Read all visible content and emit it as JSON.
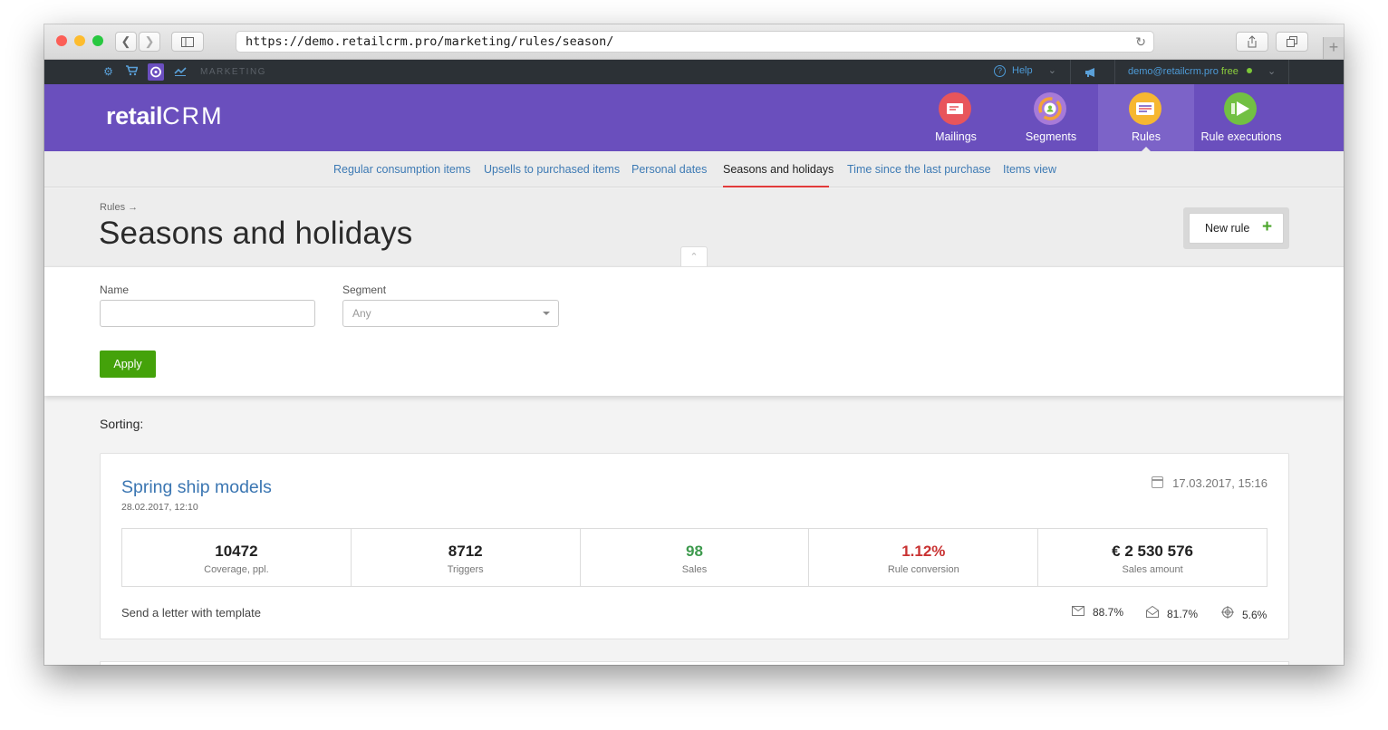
{
  "browser": {
    "url": "https://demo.retailcrm.pro/marketing/rules/season/",
    "reload_icon": "reload-icon",
    "new_tab": "+"
  },
  "topbar": {
    "section": "MARKETING",
    "help": "Help",
    "user_email": "demo@retailcrm.pro",
    "plan": "free"
  },
  "header": {
    "logo_text": "retail",
    "logo_crm": "CRM",
    "nav": [
      {
        "label": "Mailings",
        "icon": "mailings-icon",
        "color": "#e8555b"
      },
      {
        "label": "Segments",
        "icon": "segments-icon",
        "color": "#a77ad8"
      },
      {
        "label": "Rules",
        "icon": "rules-icon",
        "color": "#f6b731"
      },
      {
        "label": "Rule executions",
        "icon": "rule-executions-icon",
        "color": "#72c043"
      }
    ]
  },
  "subnav": [
    "Regular consumption items",
    "Upsells to purchased items",
    "Personal dates",
    "Seasons and holidays",
    "Time since the last purchase",
    "Items view"
  ],
  "page": {
    "breadcrumb": "Rules →",
    "title": "Seasons and holidays",
    "new_rule": "New rule",
    "new_rule_plus": "+"
  },
  "filter": {
    "name_label": "Name",
    "name_value": "",
    "segment_label": "Segment",
    "segment_value": "Any",
    "apply": "Apply"
  },
  "list": {
    "sorting_label": "Sorting:",
    "rules": [
      {
        "title": "Spring ship models",
        "created": "28.02.2017, 12:10",
        "date": "17.03.2017, 15:16",
        "stats": [
          {
            "value": "10472",
            "label": "Coverage, ppl."
          },
          {
            "value": "8712",
            "label": "Triggers"
          },
          {
            "value": "98",
            "label": "Sales"
          },
          {
            "value": "1.12%",
            "label": "Rule conversion"
          },
          {
            "value": "€ 2 530 576",
            "label": "Sales amount"
          }
        ],
        "action": "Send a letter with template",
        "metrics": [
          {
            "icon": "envelope-icon",
            "value": "88.7%"
          },
          {
            "icon": "envelope-open-icon",
            "value": "81.7%"
          },
          {
            "icon": "target-icon",
            "value": "5.6%"
          }
        ]
      }
    ]
  },
  "colors": {
    "brand_purple": "#6a4fbd",
    "topbar": "#2c3136",
    "link_blue": "#3d7ab4",
    "apply_green": "#44a20a",
    "active_tab_underline": "#e23b3b",
    "sales_green": "#3e9a4e",
    "conversion_red": "#c93232"
  }
}
